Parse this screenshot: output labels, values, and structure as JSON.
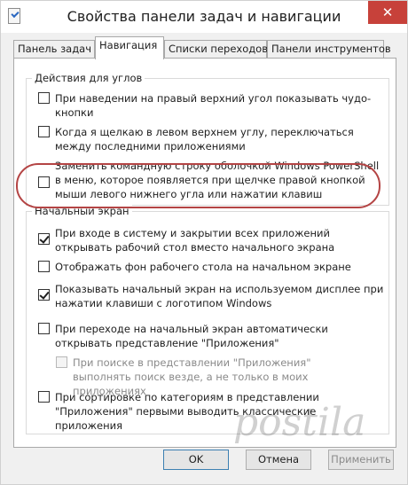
{
  "window": {
    "title": "Свойства панели задач и навигации",
    "close_glyph": "✕"
  },
  "tabs": [
    {
      "label": "Панель задач",
      "active": false
    },
    {
      "label": "Навигация",
      "active": true
    },
    {
      "label": "Списки переходов",
      "active": false
    },
    {
      "label": "Панели инструментов",
      "active": false
    }
  ],
  "corners": {
    "title": "Действия для углов",
    "options": [
      {
        "label": "При наведении на правый верхний угол показывать чудо-кнопки",
        "checked": false
      },
      {
        "label": "Когда я щелкаю в левом верхнем углу, переключаться между последними приложениями",
        "checked": false
      },
      {
        "label": "Заменить командную строку оболочкой Windows PowerShell в меню, которое появляется при щелчке правой кнопкой мыши левого нижнего угла или нажатии клавиш Windows+X",
        "checked": false
      }
    ]
  },
  "start_screen": {
    "title": "Начальный экран",
    "options": [
      {
        "label": "При входе в систему и закрытии всех приложений открывать рабочий стол вместо начального экрана",
        "checked": true
      },
      {
        "label": "Отображать фон рабочего стола на начальном экране",
        "checked": false
      },
      {
        "label": "Показывать начальный экран на используемом дисплее при нажатии клавиши с логотипом Windows",
        "checked": true
      },
      {
        "label": "При переходе на начальный экран автоматически открывать представление \"Приложения\"",
        "checked": false
      },
      {
        "label": "При поиске в представлении \"Приложения\" выполнять поиск везде, а не только в моих приложениях",
        "checked": false,
        "disabled": true
      },
      {
        "label": "При сортировке по категориям в представлении \"Приложения\" первыми выводить классические приложения",
        "checked": false
      }
    ]
  },
  "buttons": {
    "ok": "OK",
    "cancel": "Отмена",
    "apply": "Применить"
  },
  "watermark": "postila",
  "colors": {
    "close_button": "#c7413a",
    "highlight_ring": "#b44444"
  }
}
